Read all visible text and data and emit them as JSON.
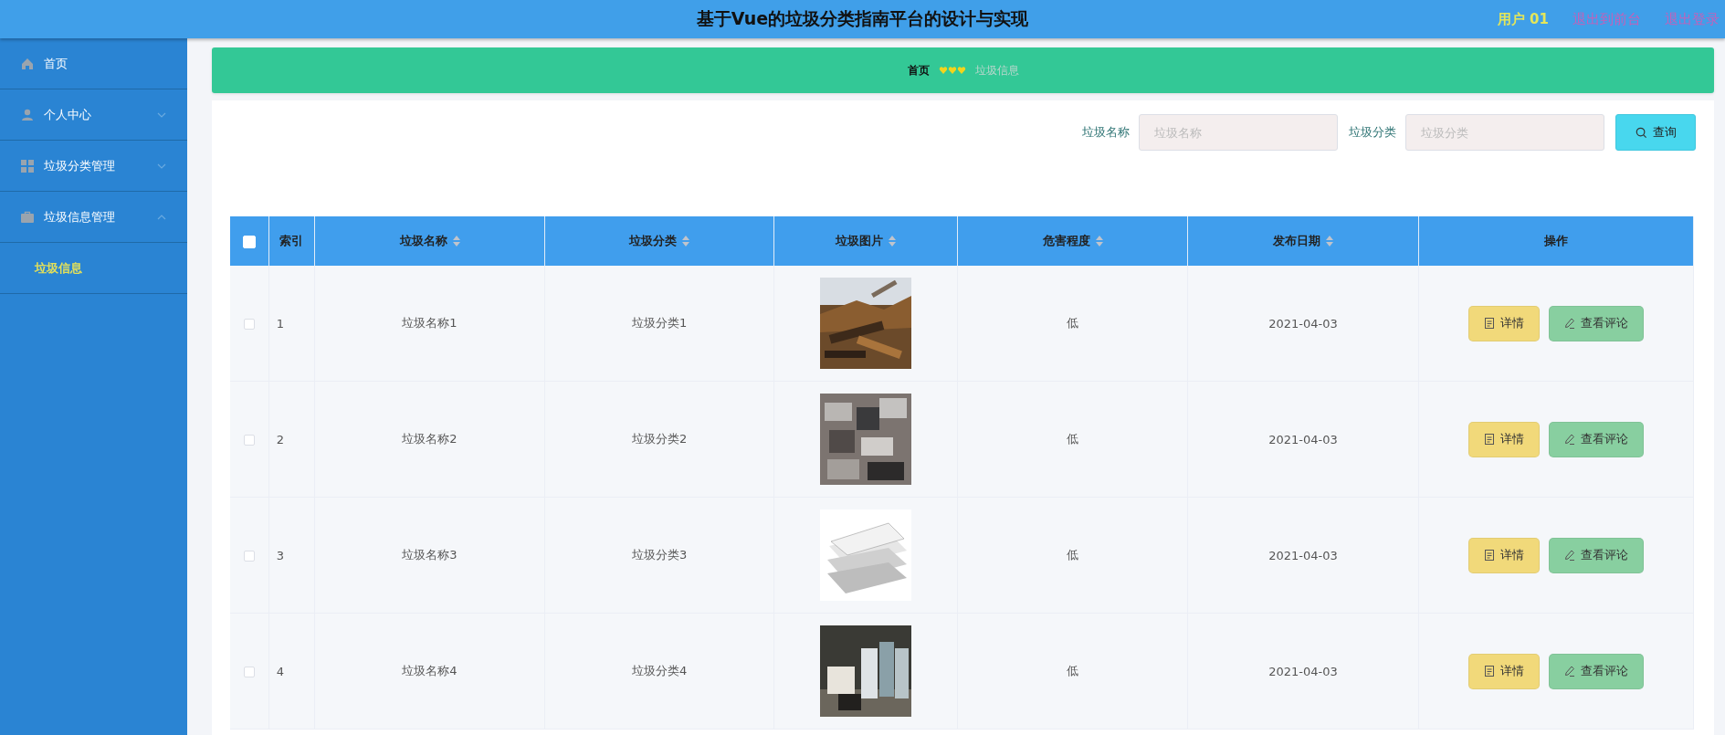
{
  "header": {
    "title": "基于Vue的垃圾分类指南平台的设计与实现",
    "user": "用户 01",
    "links": [
      "退出到前台",
      "退出登录"
    ]
  },
  "sidebar": {
    "items": [
      {
        "label": "首页"
      },
      {
        "label": "个人中心",
        "expanded": false
      },
      {
        "label": "垃圾分类管理",
        "expanded": false
      },
      {
        "label": "垃圾信息管理",
        "expanded": true,
        "children": [
          {
            "label": "垃圾信息",
            "selected": true
          }
        ]
      }
    ]
  },
  "breadcrumb": [
    "首页",
    "垃圾信息"
  ],
  "search": {
    "fields": [
      {
        "label": "垃圾名称",
        "placeholder": "垃圾名称"
      },
      {
        "label": "垃圾分类",
        "placeholder": "垃圾分类"
      }
    ],
    "button": "查询"
  },
  "table": {
    "select_all": false,
    "columns": [
      {
        "label": "索引",
        "sortable": false
      },
      {
        "label": "垃圾名称",
        "sortable": true
      },
      {
        "label": "垃圾分类",
        "sortable": true
      },
      {
        "label": "垃圾图片",
        "sortable": true
      },
      {
        "label": "危害程度",
        "sortable": true
      },
      {
        "label": "发布日期",
        "sortable": true
      },
      {
        "label": "操作",
        "sortable": false
      }
    ],
    "rows": [
      {
        "checked": false,
        "index": "1",
        "name": "垃圾名称1",
        "category": "垃圾分类1",
        "harm": "低",
        "date": "2021-04-03",
        "actions": [
          "详情",
          "查看评论"
        ]
      },
      {
        "checked": false,
        "index": "2",
        "name": "垃圾名称2",
        "category": "垃圾分类2",
        "harm": "低",
        "date": "2021-04-03",
        "actions": [
          "详情",
          "查看评论"
        ]
      },
      {
        "checked": false,
        "index": "3",
        "name": "垃圾名称3",
        "category": "垃圾分类3",
        "harm": "低",
        "date": "2021-04-03",
        "actions": [
          "详情",
          "查看评论"
        ]
      },
      {
        "checked": false,
        "index": "4",
        "name": "垃圾名称4",
        "category": "垃圾分类4",
        "harm": "低",
        "date": "2021-04-03",
        "actions": [
          "详情",
          "查看评论"
        ]
      }
    ]
  }
}
